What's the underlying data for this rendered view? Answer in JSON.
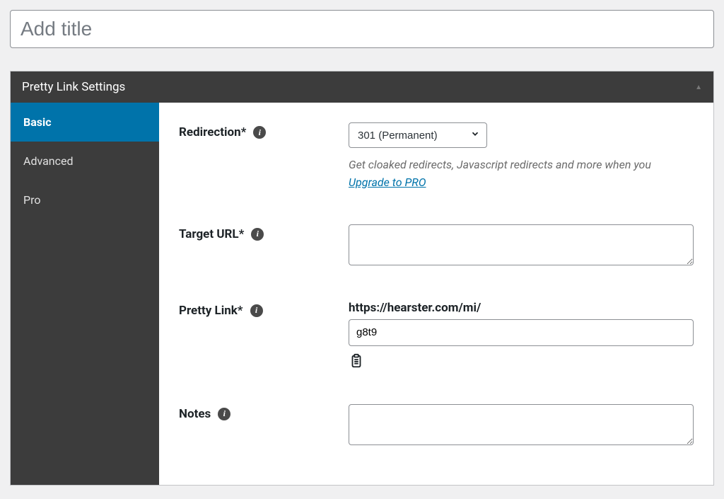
{
  "title": {
    "placeholder": "Add title",
    "value": ""
  },
  "panel": {
    "header": "Pretty Link Settings",
    "tabs": {
      "basic": "Basic",
      "advanced": "Advanced",
      "pro": "Pro"
    }
  },
  "fields": {
    "redirection": {
      "label": "Redirection*",
      "selected": "301 (Permanent)",
      "hint_pre": "Get cloaked redirects, Javascript redirects and more when you ",
      "hint_link": "Upgrade to PRO"
    },
    "target_url": {
      "label": "Target URL*",
      "value": ""
    },
    "pretty_link": {
      "label": "Pretty Link*",
      "base": "https://hearster.com/mi/",
      "slug": "g8t9"
    },
    "notes": {
      "label": "Notes",
      "value": ""
    }
  }
}
